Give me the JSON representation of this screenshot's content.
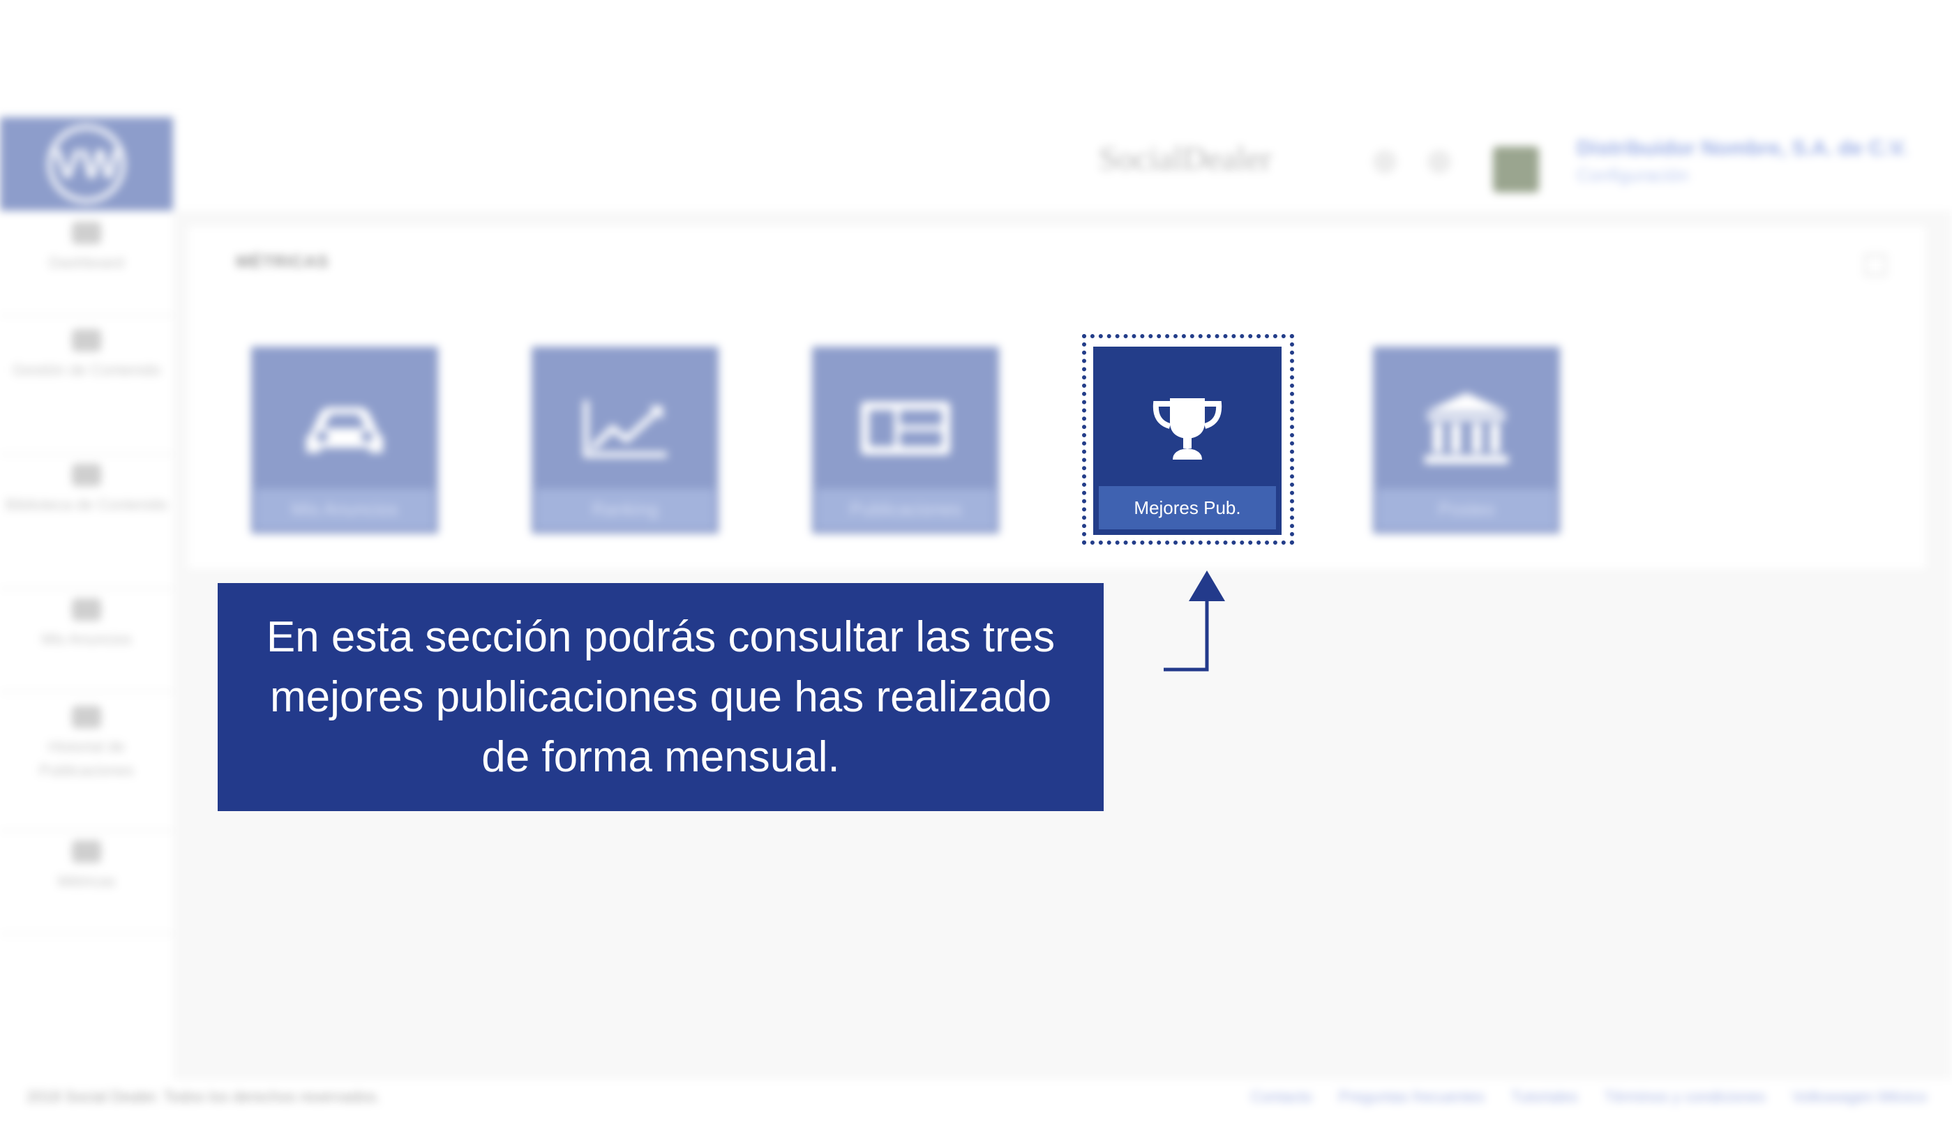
{
  "header": {
    "brand": "SocialDealer",
    "user_name": "Distribuidor Nombre, S.A. de C.V.",
    "user_role": "Configuración"
  },
  "sidebar": {
    "items": [
      {
        "label": "Dashboard",
        "icon": "home-icon"
      },
      {
        "label": "Gestión de Contenido",
        "icon": "calendar-icon"
      },
      {
        "label": "Biblioteca de Contenido",
        "icon": "folder-icon"
      },
      {
        "label": "Mis Anuncios",
        "icon": "image-icon"
      },
      {
        "label": "Historial de Publicaciones",
        "icon": "list-icon"
      },
      {
        "label": "Métricas",
        "icon": "chart-icon"
      }
    ]
  },
  "panel": {
    "title": "MÉTRICAS",
    "tiles": [
      {
        "label": "Mis Anuncios",
        "icon": "car-icon"
      },
      {
        "label": "Ranking",
        "icon": "line-chart-icon"
      },
      {
        "label": "Publicaciones",
        "icon": "layout-icon"
      },
      {
        "label": "Mejores Pub.",
        "icon": "trophy-icon"
      },
      {
        "label": "Posteo",
        "icon": "bank-icon"
      }
    ]
  },
  "callout": {
    "text": "En esta sección podrás consultar las tres mejores publicaciones que has realizado de forma mensual."
  },
  "footer": {
    "copyright": "2018 Social Dealer. Todos los derechos reservados.",
    "links": [
      "Contacto",
      "Preguntas frecuentes",
      "Tutoriales",
      "Términos y condiciones",
      "Volkswagen México"
    ]
  },
  "colors": {
    "accent": "#233a8b",
    "tile_faded": "#8d9dcb"
  }
}
